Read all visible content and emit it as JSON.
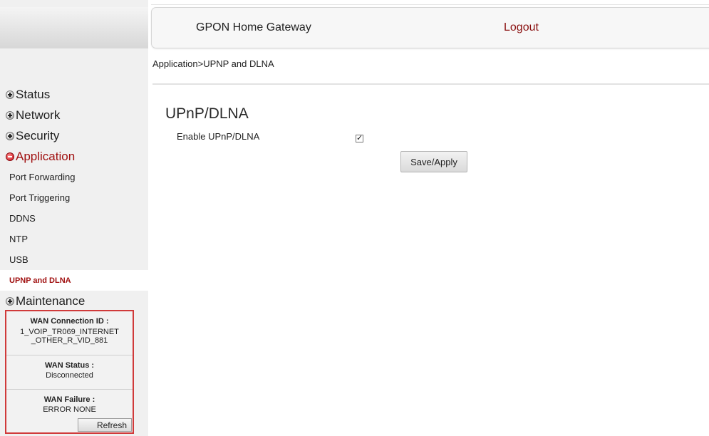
{
  "header": {
    "title": "GPON Home Gateway",
    "logout_label": "Logout"
  },
  "breadcrumb": "Application>UPNP and DLNA",
  "sidebar": {
    "items": [
      {
        "label": "Status",
        "icon": "plus-circle-icon",
        "expanded": false
      },
      {
        "label": "Network",
        "icon": "plus-circle-icon",
        "expanded": false
      },
      {
        "label": "Security",
        "icon": "plus-circle-icon",
        "expanded": false
      },
      {
        "label": "Application",
        "icon": "minus-circle-icon",
        "expanded": true
      },
      {
        "label": "Maintenance",
        "icon": "plus-circle-icon",
        "expanded": false
      }
    ],
    "sub_items": [
      {
        "label": "Port Forwarding"
      },
      {
        "label": "Port Triggering"
      },
      {
        "label": "DDNS"
      },
      {
        "label": "NTP"
      },
      {
        "label": "USB"
      },
      {
        "label": "UPNP and DLNA",
        "selected": true
      }
    ]
  },
  "wan": {
    "connection_id_label": "WAN Connection ID :",
    "connection_id_line1": "1_VOIP_TR069_INTERNET",
    "connection_id_line2": "_OTHER_R_VID_881",
    "status_label": "WAN Status :",
    "status_value": "Disconnected",
    "failure_label": "WAN Failure :",
    "failure_value": "ERROR NONE",
    "refresh_label": "Refresh"
  },
  "main": {
    "section_title": "UPnP/DLNA",
    "enable_label": "Enable UPnP/DLNA",
    "enable_checked": true,
    "checkmark": "✓",
    "save_label": "Save/Apply"
  },
  "colors": {
    "active_nav": "#a01010",
    "logout": "#8a1010",
    "wan_border": "#d03a3a",
    "sidebar_bg": "#f0f0f0"
  }
}
